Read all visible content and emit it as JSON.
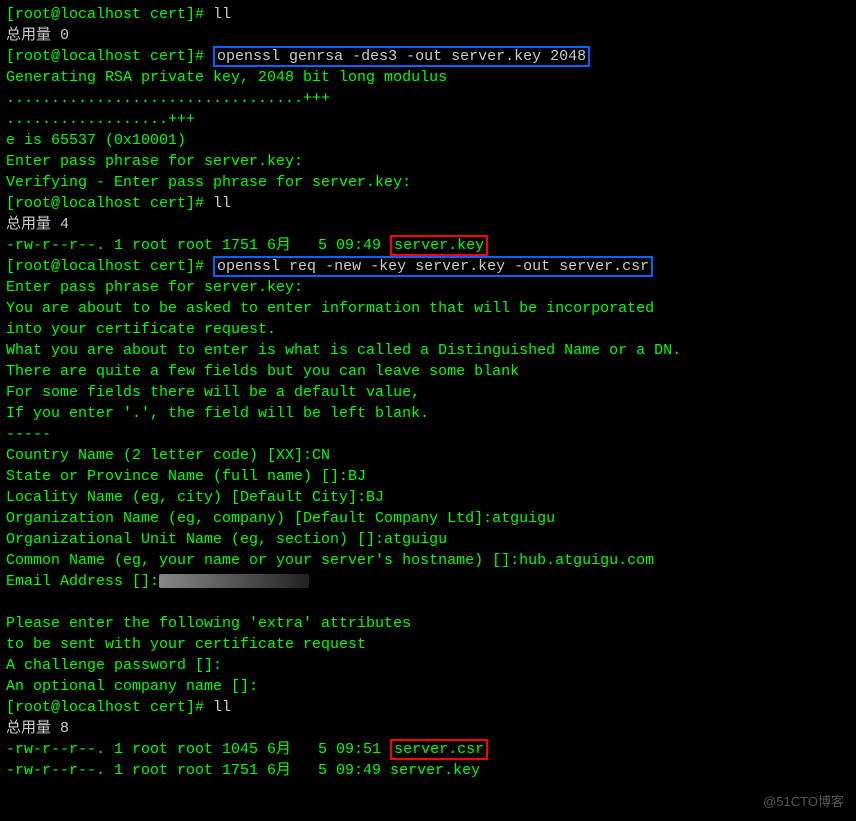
{
  "prompt1": "[root@localhost cert]# ",
  "cmd_ll": "ll",
  "total0": "总用量 0",
  "cmd_genrsa": "openssl genrsa -des3 -out server.key 2048",
  "gen_msg": "Generating RSA private key, 2048 bit long modulus",
  "dots1": ".................................+++",
  "dots2": "..................+++",
  "e_line": "e is 65537 (0x10001)",
  "enter_pass": "Enter pass phrase for server.key:",
  "verify_pass": "Verifying - Enter pass phrase for server.key:",
  "total4": "总用量 4",
  "ls_key_pre": "-rw-r--r--. 1 root root 1751 6月   5 09:49 ",
  "server_key": "server.key",
  "cmd_req": "openssl req -new -key server.key -out server.csr",
  "req_info1": "You are about to be asked to enter information that will be incorporated",
  "req_info2": "into your certificate request.",
  "req_info3": "What you are about to enter is what is called a Distinguished Name or a DN.",
  "req_info4": "There are quite a few fields but you can leave some blank",
  "req_info5": "For some fields there will be a default value,",
  "req_info6": "If you enter '.', the field will be left blank.",
  "dashes": "-----",
  "country": "Country Name (2 letter code) [XX]:CN",
  "state": "State or Province Name (full name) []:BJ",
  "locality": "Locality Name (eg, city) [Default City]:BJ",
  "org": "Organization Name (eg, company) [Default Company Ltd]:atguigu",
  "orgunit": "Organizational Unit Name (eg, section) []:atguigu",
  "common": "Common Name (eg, your name or your server's hostname) []:hub.atguigu.com",
  "email_label": "Email Address []:",
  "extra1": "Please enter the following 'extra' attributes",
  "extra2": "to be sent with your certificate request",
  "challenge": "A challenge password []:",
  "optcompany": "An optional company name []:",
  "total8": "总用量 8",
  "ls_csr_pre": "-rw-r--r--. 1 root root 1045 6月   5 09:51 ",
  "server_csr": "server.csr",
  "ls_key2": "-rw-r--r--. 1 root root 1751 6月   5 09:49 server.key",
  "watermark": "@51CTO博客"
}
